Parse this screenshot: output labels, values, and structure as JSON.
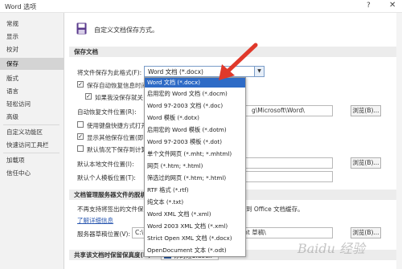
{
  "window": {
    "title": "Word 选项",
    "help": "?",
    "close": "✕"
  },
  "sidebar": {
    "items": [
      {
        "label": "常规"
      },
      {
        "label": "显示"
      },
      {
        "label": "校对"
      },
      {
        "label": "保存"
      },
      {
        "label": "版式"
      },
      {
        "label": "语言"
      },
      {
        "label": "轻松访问"
      },
      {
        "label": "高级"
      },
      {
        "label": "自定义功能区"
      },
      {
        "label": "快速访问工具栏"
      },
      {
        "label": "加载项"
      },
      {
        "label": "信任中心"
      }
    ],
    "active_index": 3
  },
  "header": {
    "text": "自定义文档保存方式。"
  },
  "sections": {
    "save_docs": "保存文档",
    "server_files": "文档管理服务器文件的脱机",
    "fidelity": "共享该文档时保留保真度(D):"
  },
  "form": {
    "format_label": "将文件保存为此格式(F):",
    "format_value": "Word 文档 (*.docx)",
    "autosave_label": "保存自动恢复信息时间",
    "keep_last_label": "如果我没保存就关",
    "autorecover_label": "自动恢复文件位置(R):",
    "autorecover_path": "g\\Microsoft\\Word\\",
    "browse1": "浏览(B)...",
    "shortcut_label": "使用键盘快捷方式打开",
    "show_more_label": "显示其他保存位置(即",
    "default_pc_label": "默认情况下保存到计算",
    "local_loc_label": "默认本地文件位置(I):",
    "browse2": "浏览(B)...",
    "personal_template_label": "默认个人模板位置(T):",
    "server_desc_left": "不再支持将签出的文件保",
    "server_desc_right": "到 Office 文档缓存。",
    "learn_more": "了解详细信息",
    "draft_label": "服务器草稿位置(V):",
    "draft_path": "C:\\Users\\baidu\\Documents\\SharePoint 草稿\\",
    "browse3": "浏览(B)...",
    "doc_name": "你的姓1.docx"
  },
  "dropdown": {
    "selected_index": 0,
    "options": [
      "Word 文档 (*.docx)",
      "启用宏的 Word 文档 (*.docm)",
      "Word 97-2003 文档 (*.doc)",
      "Word 模板 (*.dotx)",
      "启用宏的 Word 模板 (*.dotm)",
      "Word 97-2003 模板 (*.dot)",
      "单个文件网页 (*.mht; *.mhtml)",
      "网页 (*.htm; *.html)",
      "筛选过的网页 (*.htm; *.html)",
      "RTF 格式 (*.rtf)",
      "纯文本 (*.txt)",
      "Word XML 文档 (*.xml)",
      "Word 2003 XML 文档 (*.xml)",
      "Strict Open XML 文档 (*.docx)",
      "OpenDocument 文本 (*.odt)"
    ]
  },
  "watermark": "Baidu 经验",
  "colors": {
    "selected": "#2e6bc6",
    "link": "#2b58b0",
    "arrow": "#e0392b",
    "active_nav": "#d4d4d4"
  }
}
